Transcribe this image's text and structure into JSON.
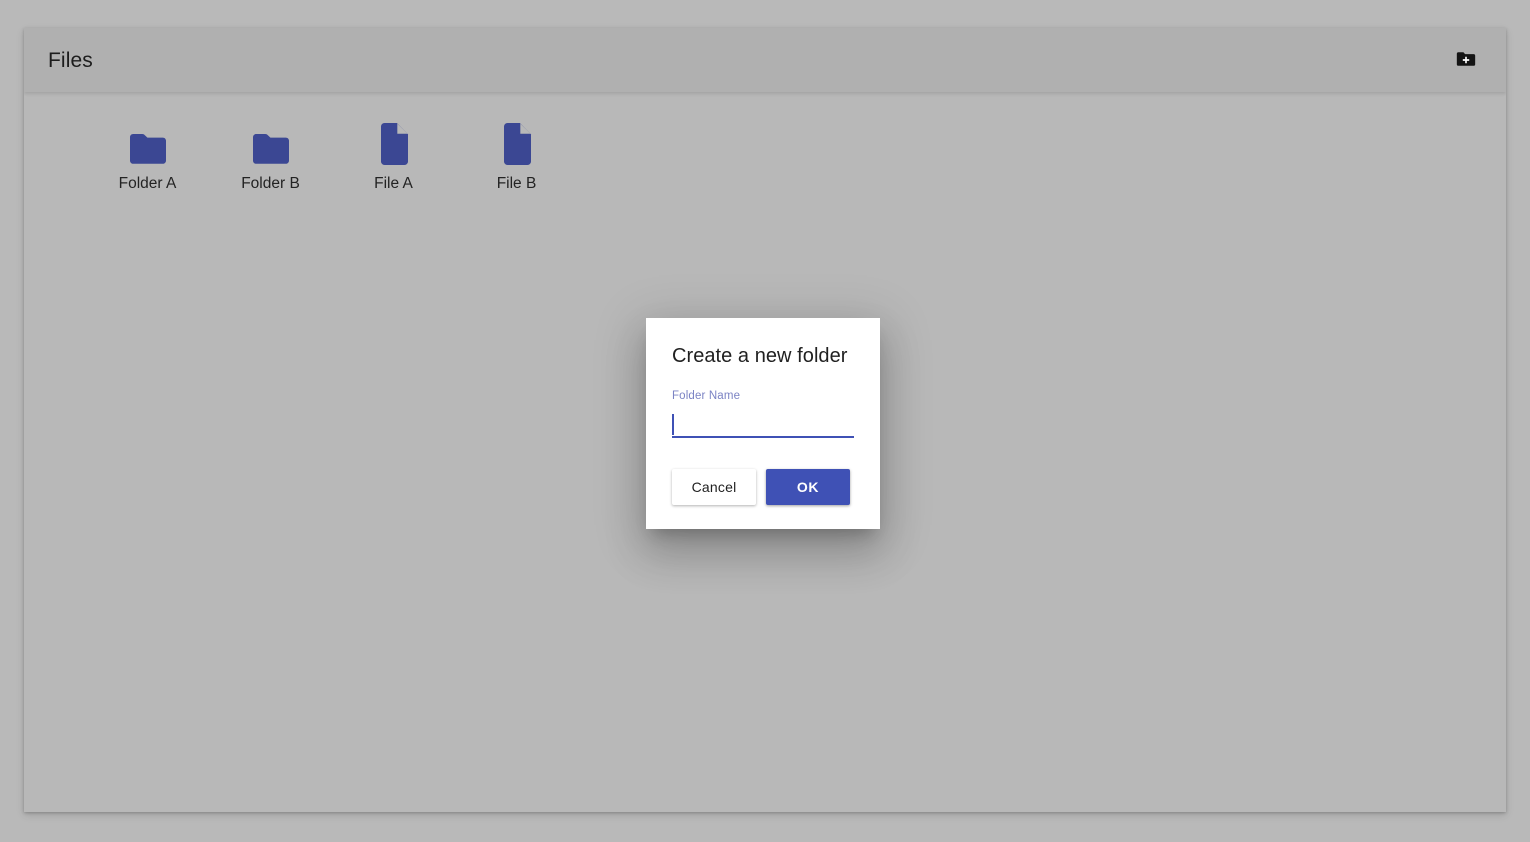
{
  "window": {
    "background_color": "#b9b9b9",
    "card_background_color": "#b8b8b8"
  },
  "toolbar": {
    "title": "Files",
    "header_color": "#b0b0b0",
    "new_folder_icon": "create-new-folder-icon"
  },
  "files": {
    "items": [
      {
        "label": "Folder A",
        "type": "folder",
        "icon": "folder-icon",
        "color": "#3b4793"
      },
      {
        "label": "Folder B",
        "type": "folder",
        "icon": "folder-icon",
        "color": "#3b4793"
      },
      {
        "label": "File A",
        "type": "file",
        "icon": "file-icon",
        "color": "#3b4793"
      },
      {
        "label": "File B",
        "type": "file",
        "icon": "file-icon",
        "color": "#3b4793"
      }
    ]
  },
  "dialog": {
    "title": "Create a new folder",
    "field": {
      "label": "Folder Name",
      "value": "",
      "placeholder": ""
    },
    "cancel_label": "Cancel",
    "ok_label": "OK",
    "accent_color": "#3f51b5",
    "label_color": "#7b83c4"
  }
}
